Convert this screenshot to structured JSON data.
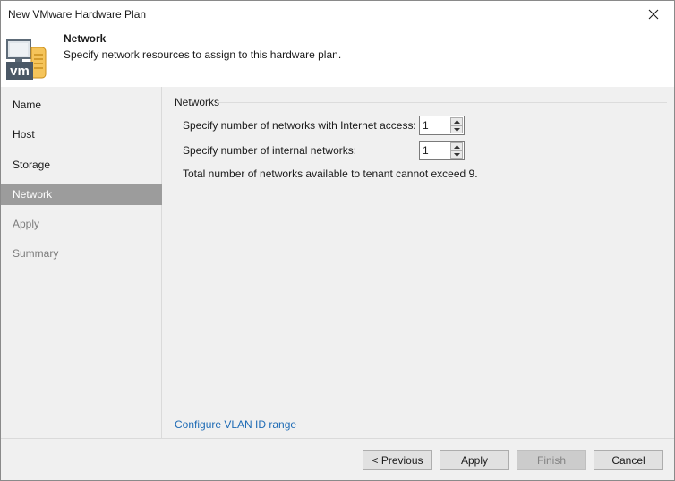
{
  "window": {
    "title": "New VMware Hardware Plan"
  },
  "header": {
    "title": "Network",
    "subtitle": "Specify network resources to assign to this hardware plan.",
    "logo_text": "vm"
  },
  "sidebar": {
    "items": [
      {
        "label": "Name",
        "state": "normal"
      },
      {
        "label": "Host",
        "state": "normal"
      },
      {
        "label": "Storage",
        "state": "normal"
      },
      {
        "label": "Network",
        "state": "active"
      },
      {
        "label": "Apply",
        "state": "disabled"
      },
      {
        "label": "Summary",
        "state": "disabled"
      }
    ]
  },
  "main": {
    "group_label": "Networks",
    "internet_networks": {
      "label": "Specify number of networks with Internet access:",
      "value": "1"
    },
    "internal_networks": {
      "label": "Specify number of internal networks:",
      "value": "1"
    },
    "note": "Total number of networks available to tenant cannot exceed 9.",
    "vlan_link": "Configure VLAN ID range"
  },
  "footer": {
    "previous_label": "< Previous",
    "apply_label": "Apply",
    "finish_label": "Finish",
    "cancel_label": "Cancel"
  },
  "colors": {
    "active_nav": "#9c9c9c",
    "link": "#1e6bb5",
    "background": "#f0f0f0"
  }
}
